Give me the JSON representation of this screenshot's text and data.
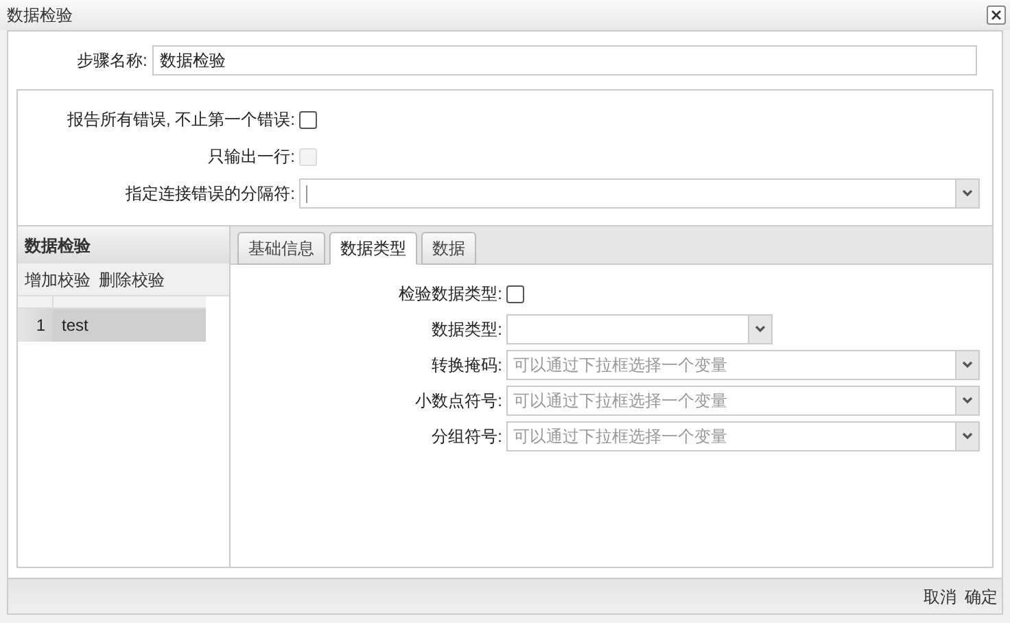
{
  "window": {
    "title": "数据检验"
  },
  "step_name": {
    "label": "步骤名称:",
    "value": "数据检验"
  },
  "options": [
    {
      "kind": "checkbox",
      "label": "报告所有错误, 不止第一个错误:",
      "checked": false,
      "disabled": false
    },
    {
      "kind": "checkbox",
      "label": "只输出一行:",
      "checked": false,
      "disabled": true
    },
    {
      "kind": "combo",
      "label": "指定连接错误的分隔符:"
    }
  ],
  "validations": {
    "title": "数据检验",
    "actions": [
      "增加校验",
      "删除校验"
    ],
    "rows": [
      {
        "index": "1",
        "name": "test",
        "selected": true
      }
    ]
  },
  "tabs": [
    {
      "label": "基础信息",
      "selected": false
    },
    {
      "label": "数据类型",
      "selected": true
    },
    {
      "label": "数据",
      "selected": false
    }
  ],
  "tab_fields": [
    {
      "kind": "checkbox",
      "label": "检验数据类型:",
      "checked": false
    },
    {
      "kind": "select",
      "label": "数据类型:"
    },
    {
      "kind": "combo",
      "label": "转换掩码:",
      "placeholder": "可以通过下拉框选择一个变量"
    },
    {
      "kind": "combo",
      "label": "小数点符号:",
      "placeholder": "可以通过下拉框选择一个变量"
    },
    {
      "kind": "combo",
      "label": "分组符号:",
      "placeholder": "可以通过下拉框选择一个变量"
    }
  ],
  "buttons": [
    "取消",
    "确定"
  ]
}
